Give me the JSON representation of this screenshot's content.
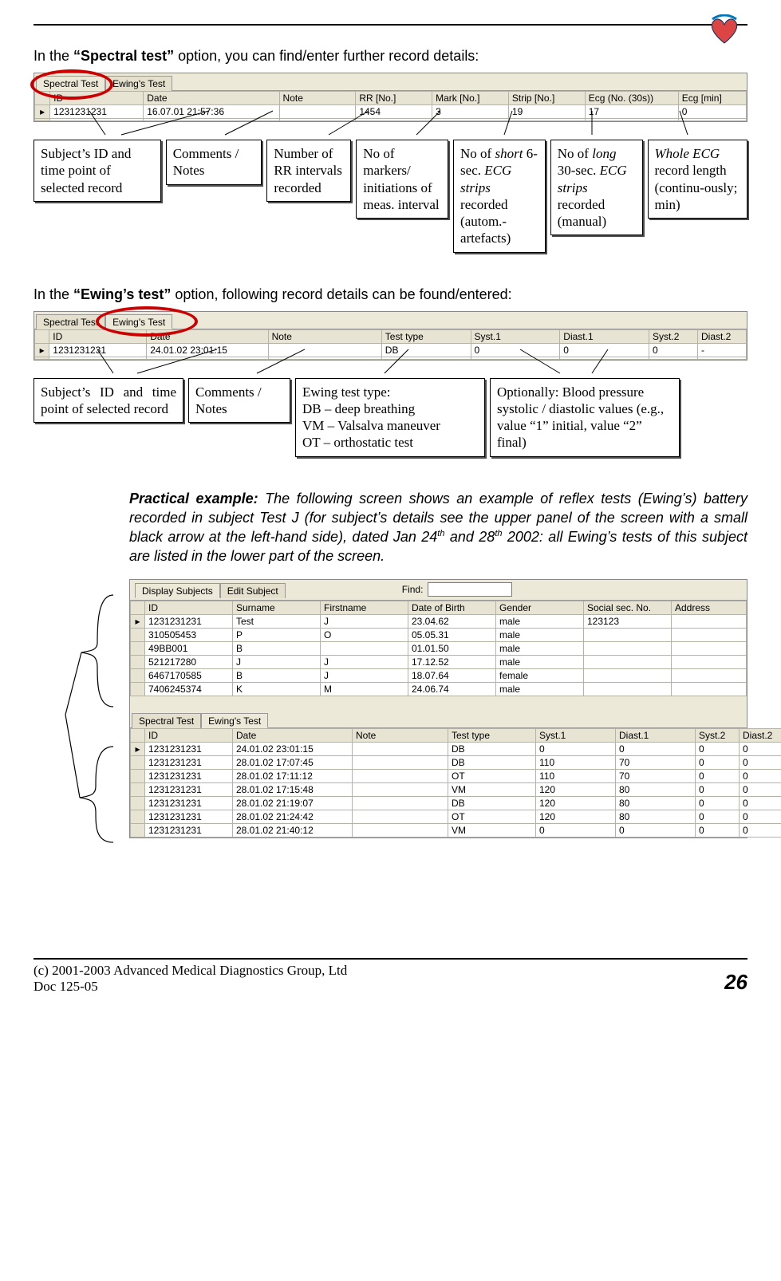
{
  "logo_name": "heart-logo",
  "intro1_pre": "In the ",
  "intro1_bold": "“Spectral test”",
  "intro1_post": " option, you can find/enter further record details:",
  "spectral_tabs": [
    "Spectral Test",
    "Ewing's Test"
  ],
  "spectral_headers": [
    "",
    "ID",
    "Date",
    "Note",
    "RR [No.]",
    "Mark [No.]",
    "Strip [No.]",
    "Ecg (No. (30s))",
    "Ecg [min]"
  ],
  "spectral_rows": [
    [
      "▸",
      "1231231231",
      "16.07.01 21:57:36",
      "",
      "1454",
      "3",
      "19",
      "17",
      "0"
    ],
    [
      "",
      "",
      "",
      "",
      "",
      "",
      "",
      "",
      ""
    ]
  ],
  "spectral_callouts": [
    "Subject’s ID and time point of selected record",
    "Comments / Notes",
    "Number of RR intervals recorded",
    "No of markers/ initiations of meas. interval",
    "No of short 6-sec. ECG strips recorded (autom.-artefacts)",
    "No of long 30-sec. ECG strips recorded (manual)",
    "Whole ECG record length (continu-ously; min)"
  ],
  "intro2_pre": "In the ",
  "intro2_bold": "“Ewing’s test”",
  "intro2_post": " option, following record details can be found/entered:",
  "ewing_tabs": [
    "Spectral Test",
    "Ewing's Test"
  ],
  "ewing_headers": [
    "",
    "ID",
    "Date",
    "Note",
    "Test type",
    "Syst.1",
    "Diast.1",
    "Syst.2",
    "Diast.2"
  ],
  "ewing_rows": [
    [
      "▸",
      "1231231231",
      "24.01.02 23:01:15",
      "",
      "DB",
      "0",
      "0",
      "0",
      "-"
    ],
    [
      "",
      "",
      "",
      "",
      "",
      "",
      "",
      "",
      ""
    ]
  ],
  "ewing_callouts": [
    "Subject’s ID and time point of selected record",
    "Comments / Notes",
    "Ewing test type:\nDB – deep breathing\nVM – Valsalva maneuver\nOT – orthostatic test",
    "Optionally: Blood pressure systolic / diastolic values (e.g., value “1” initial, value “2” final)"
  ],
  "practical_lead": "Practical example:",
  "practical_text": " The following screen shows an example of reflex tests (Ewing’s) battery recorded in subject Test J (for subject’s details see the upper panel of the screen with a small black arrow at the left-hand side), dated Jan 24",
  "practical_sup1": "th",
  "practical_text2": " and 28",
  "practical_sup2": "th",
  "practical_text3": " 2002: all Ewing’s tests of this subject are listed in the lower part of the screen.",
  "find_label": "Find:",
  "subjects_tabs": [
    "Display Subjects",
    "Edit Subject"
  ],
  "subjects_headers": [
    "",
    "ID",
    "Surname",
    "Firstname",
    "Date of Birth",
    "Gender",
    "Social sec. No.",
    "Address"
  ],
  "subjects_rows": [
    [
      "▸",
      "1231231231",
      "Test",
      "J",
      "23.04.62",
      "male",
      "123123",
      ""
    ],
    [
      "",
      "310505453",
      "P",
      "O",
      "05.05.31",
      "male",
      "",
      ""
    ],
    [
      "",
      "49BB001",
      "B",
      "",
      "01.01.50",
      "male",
      "",
      ""
    ],
    [
      "",
      "521217280",
      "J",
      "J",
      "17.12.52",
      "male",
      "",
      ""
    ],
    [
      "",
      "6467170585",
      "B",
      "J",
      "18.07.64",
      "female",
      "",
      ""
    ],
    [
      "",
      "7406245374",
      "K",
      "M",
      "24.06.74",
      "male",
      "",
      ""
    ]
  ],
  "lower_tabs": [
    "Spectral Test",
    "Ewing's Test"
  ],
  "lower_headers": [
    "",
    "ID",
    "Date",
    "Note",
    "Test type",
    "Syst.1",
    "Diast.1",
    "Syst.2",
    "Diast.2"
  ],
  "lower_rows": [
    [
      "▸",
      "1231231231",
      "24.01.02 23:01:15",
      "",
      "DB",
      "0",
      "0",
      "0",
      "0"
    ],
    [
      "",
      "1231231231",
      "28.01.02 17:07:45",
      "",
      "DB",
      "110",
      "70",
      "0",
      "0"
    ],
    [
      "",
      "1231231231",
      "28.01.02 17:11:12",
      "",
      "OT",
      "110",
      "70",
      "0",
      "0"
    ],
    [
      "",
      "1231231231",
      "28.01.02 17:15:48",
      "",
      "VM",
      "120",
      "80",
      "0",
      "0"
    ],
    [
      "",
      "1231231231",
      "28.01.02 21:19:07",
      "",
      "DB",
      "120",
      "80",
      "0",
      "0"
    ],
    [
      "",
      "1231231231",
      "28.01.02 21:24:42",
      "",
      "OT",
      "120",
      "80",
      "0",
      "0"
    ],
    [
      "",
      "1231231231",
      "28.01.02 21:40:12",
      "",
      "VM",
      "0",
      "0",
      "0",
      "0"
    ]
  ],
  "footer_copy": "(c) 2001-2003 Advanced Medical Diagnostics Group, Ltd",
  "footer_doc": "Doc 125-05",
  "page_num": "26"
}
